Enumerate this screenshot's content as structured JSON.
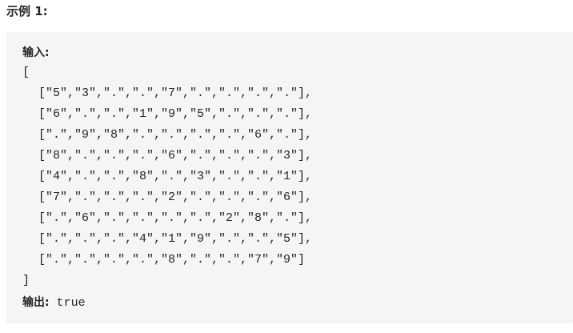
{
  "heading": "示例 1:",
  "input_label": "输入:",
  "open_bracket": "[",
  "rows": [
    "[\"5\",\"3\",\".\",\".\",\"7\",\".\",\".\",\".\",\".\"],",
    "[\"6\",\".\",\".\",\"1\",\"9\",\"5\",\".\",\".\",\".\"],",
    "[\".\",\"9\",\"8\",\".\",\".\",\".\",\".\",\"6\",\".\"],",
    "[\"8\",\".\",\".\",\".\",\"6\",\".\",\".\",\".\",\"3\"],",
    "[\"4\",\".\",\".\",\"8\",\".\",\"3\",\".\",\".\",\"1\"],",
    "[\"7\",\".\",\".\",\".\",\"2\",\".\",\".\",\".\",\"6\"],",
    "[\".\",\"6\",\".\",\".\",\".\",\".\",\"2\",\"8\",\".\"],",
    "[\".\",\".\",\".\",\"4\",\"1\",\"9\",\".\",\".\",\"5\"],",
    "[\".\",\".\",\".\",\".\",\"8\",\".\",\".\",\"7\",\"9\"]"
  ],
  "close_bracket": "]",
  "output_label": "输出:",
  "output_value": " true"
}
